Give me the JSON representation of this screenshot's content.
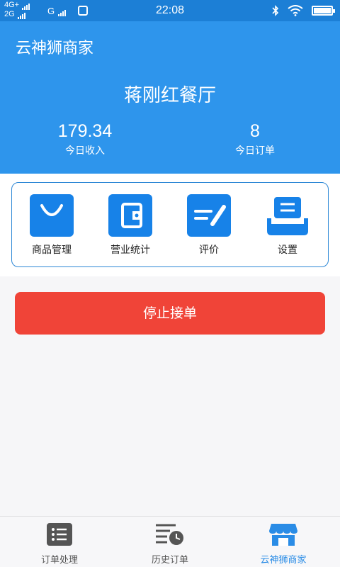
{
  "status_bar": {
    "net_top": "4G+",
    "net_bottom": "2G",
    "net_g": "G",
    "time": "22:08"
  },
  "header": {
    "brand": "云神狮商家",
    "shop_name": "蒋刚红餐厅",
    "stats": [
      {
        "value": "179.34",
        "label": "今日收入"
      },
      {
        "value": "8",
        "label": "今日订单"
      }
    ]
  },
  "functions": [
    {
      "label": "商品管理",
      "icon": "shopping-bag-icon"
    },
    {
      "label": "营业统计",
      "icon": "wallet-icon"
    },
    {
      "label": "评价",
      "icon": "pen-note-icon"
    },
    {
      "label": "设置",
      "icon": "settings-tray-icon"
    }
  ],
  "stop_button": "停止接单",
  "nav": [
    {
      "label": "订单处理",
      "icon": "list-icon",
      "active": false
    },
    {
      "label": "历史订单",
      "icon": "history-clock-icon",
      "active": false
    },
    {
      "label": "云神狮商家",
      "icon": "store-icon",
      "active": true
    }
  ],
  "colors": {
    "header_blue": "#2e95ec",
    "status_blue": "#1c7fd6",
    "icon_blue": "#1782e8",
    "stop_red": "#f04438",
    "active_tab": "#2a8ce6"
  }
}
